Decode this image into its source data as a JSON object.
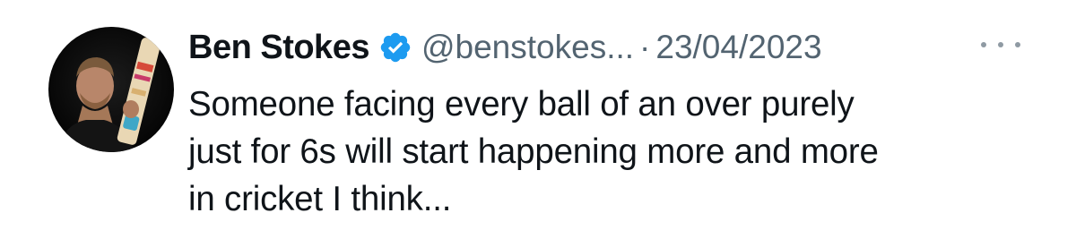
{
  "tweet": {
    "author": {
      "name": "Ben Stokes",
      "handle": "@benstokes...",
      "verified": true,
      "avatar_icon": "profile-photo-cricketer"
    },
    "separator": "·",
    "date": "23/04/2023",
    "more_icon": "more-horizontal-icon",
    "text_lines": [
      "Someone facing every ball of an over purely",
      "just for 6s will start happening more and more",
      "in cricket I think..."
    ]
  },
  "colors": {
    "text_primary": "#0f1419",
    "text_secondary": "#536471",
    "verified_blue": "#1d9bf0",
    "background": "#ffffff"
  }
}
